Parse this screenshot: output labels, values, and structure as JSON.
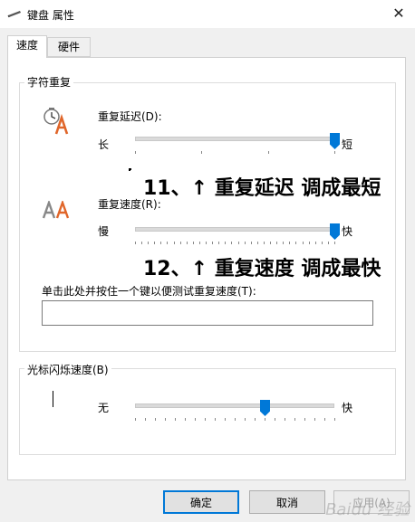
{
  "window": {
    "title": "键盘 属性",
    "close_glyph": "✕"
  },
  "tabs": [
    {
      "label": "速度",
      "active": true
    },
    {
      "label": "硬件",
      "active": false
    }
  ],
  "char_repeat": {
    "group_title": "字符重复",
    "delay": {
      "label": "重复延迟(D):",
      "min_label": "长",
      "max_label": "短",
      "value": 1.0,
      "tick_count": 4
    },
    "rate": {
      "label": "重复速度(R):",
      "min_label": "慢",
      "max_label": "快",
      "value": 1.0,
      "tick_count": 32
    },
    "test_label": "单击此处并按住一个键以便测试重复速度(T):",
    "test_value": ""
  },
  "cursor_blink": {
    "group_title": "光标闪烁速度(B)",
    "min_label": "无",
    "max_label": "快",
    "value": 0.65,
    "tick_count": 21
  },
  "annotations": {
    "step11": "11、↑  重复延迟 调成最短",
    "step12": "12、↑  重复速度 调成最快"
  },
  "buttons": {
    "ok": "确定",
    "cancel": "取消",
    "apply": "应用(A)"
  },
  "watermark": "Baidu 经验",
  "colors": {
    "accent": "#0078d7",
    "icon_orange": "#e0662a"
  }
}
